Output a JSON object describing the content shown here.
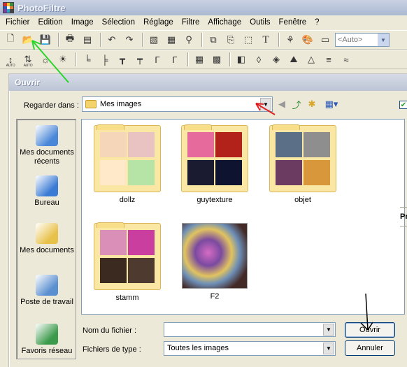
{
  "app": {
    "title": "PhotoFiltre",
    "logo_colors": [
      "#d42f2f",
      "#f2c12e",
      "#3b8c3a",
      "#2c5bb8",
      "#ffffff",
      "#e07a2d",
      "#7b3fa0",
      "#2ea0c9",
      "#444444"
    ]
  },
  "menu": [
    "Fichier",
    "Edition",
    "Image",
    "Sélection",
    "Réglage",
    "Filtre",
    "Affichage",
    "Outils",
    "Fenêtre",
    "?"
  ],
  "toolbar1": {
    "icons": [
      "new-document-icon",
      "open-folder-icon",
      "save-icon",
      "print-icon",
      "scan-icon",
      "undo-icon",
      "redo-icon",
      "fill-icon",
      "grid-icon",
      "walk-icon",
      "copy-page-icon",
      "paste-page-icon",
      "selection-icon",
      "text-icon",
      "tree-icon",
      "palette-icon",
      "window-icon"
    ],
    "zoom_combo": "<Auto>"
  },
  "toolbar2": {
    "auto_label": "AUTO",
    "icons": [
      "contrast-auto-icon",
      "levels-auto-icon",
      "brightness-minus-icon",
      "brightness-plus-icon",
      "darken-minus-icon",
      "darken-plus-icon",
      "shift-minus-icon",
      "shift-plus-icon",
      "gamma-minus-icon",
      "gamma-plus-icon",
      "mosaic-icon",
      "frame-icon",
      "filter-icon",
      "drop-icon",
      "water-icon",
      "mountain-icon",
      "triangle-icon",
      "lines-icon",
      "wave-icon",
      "pane-icon"
    ]
  },
  "dialog": {
    "title": "Ouvrir",
    "look_in_label": "Regarder dans :",
    "look_in_value": "Mes images",
    "right_fragment": "Pr",
    "places": [
      {
        "label": "Mes documents récents",
        "icon": "recent-documents-icon",
        "color": "#4a87d8"
      },
      {
        "label": "Bureau",
        "icon": "desktop-icon",
        "color": "#3a7bd5"
      },
      {
        "label": "Mes documents",
        "icon": "my-documents-icon",
        "color": "#e8c14a"
      },
      {
        "label": "Poste de travail",
        "icon": "my-computer-icon",
        "color": "#5a8fd0"
      },
      {
        "label": "Favoris réseau",
        "icon": "network-places-icon",
        "color": "#3b9a4b"
      }
    ],
    "files": [
      {
        "name": "dollz",
        "kind": "folder",
        "colors": [
          "#f6d6b8",
          "#e9c2c2",
          "#ffe9c9",
          "#b6e3a6"
        ]
      },
      {
        "name": "guytexture",
        "kind": "folder",
        "colors": [
          "#e66a9c",
          "#b2221a",
          "#1a1a30",
          "#0e1430"
        ]
      },
      {
        "name": "objet",
        "kind": "folder",
        "colors": [
          "#5b6f86",
          "#8e8e8e",
          "#6b3b62",
          "#d8973a"
        ]
      },
      {
        "name": "stamm",
        "kind": "folder",
        "colors": [
          "#d98fb7",
          "#c93e9f",
          "#3a2a20",
          "#4f3a30"
        ]
      },
      {
        "name": "F2",
        "kind": "image"
      }
    ],
    "file_name_label": "Nom du fichier :",
    "file_name_value": "",
    "file_type_label": "Fichiers de type :",
    "file_type_value": "Toutes les images",
    "open_button": "Ouvrir",
    "cancel_button": "Annuler"
  },
  "annotations": {
    "green_arrow_color": "#2bd42b",
    "red_arrow_color": "#e02020",
    "black_arrow_color": "#000000"
  }
}
